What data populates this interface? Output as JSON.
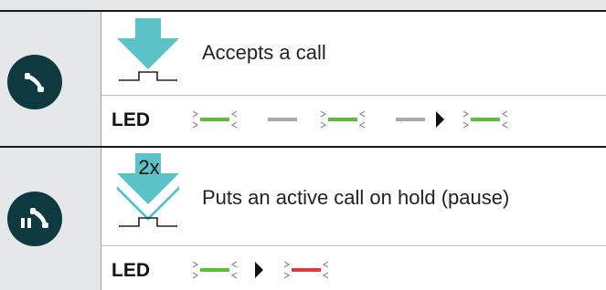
{
  "rows": [
    {
      "button_icon": "phone-accept-icon",
      "action_icon": "press-arrow-icon",
      "description": "Accepts a call",
      "led_label": "LED",
      "led_sequence": [
        "green-blink",
        "gray-steady",
        "green-blink",
        "gray-steady",
        "arrow-right",
        "green-blink"
      ]
    },
    {
      "button_icon": "phone-hold-icon",
      "action_icon": "press-arrow-icon",
      "press_count": "2x",
      "description": "Puts an active call on hold (pause)",
      "led_label": "LED",
      "led_sequence": [
        "green-blink",
        "arrow-right",
        "red-blink"
      ]
    }
  ],
  "colors": {
    "accent_teal": "#5bc3c8",
    "button_dark": "#0c3a3f",
    "led_green": "#5bbf3a",
    "led_red": "#e03a3e",
    "led_gray": "#a7a9ac",
    "panel_gray": "#e6e7e8"
  }
}
